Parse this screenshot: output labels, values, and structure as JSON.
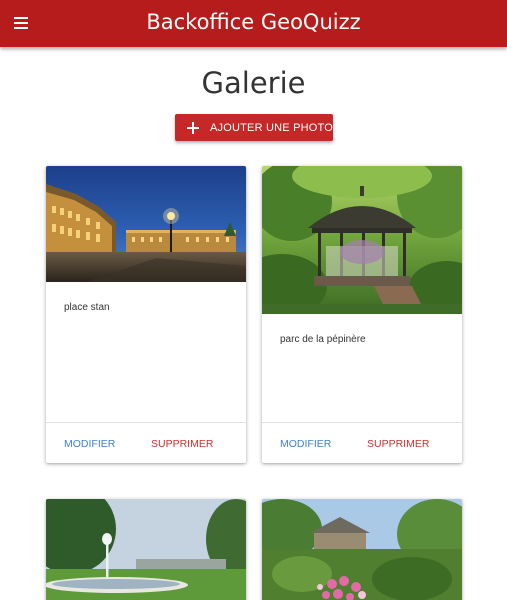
{
  "header": {
    "title": "Backoffice GeoQuizz",
    "menu_icon": "hamburger-menu-icon",
    "color": "#b71c1c"
  },
  "page": {
    "title": "Galerie"
  },
  "add_button": {
    "label": "AJOUTER UNE PHOTO",
    "icon": "plus-icon",
    "color": "#c62828"
  },
  "cards": [
    {
      "caption": "place stan",
      "modify_label": "MODIFIER",
      "delete_label": "SUPPRIMER"
    },
    {
      "caption": "parc de la pépinère",
      "modify_label": "MODIFIER",
      "delete_label": "SUPPRIMER"
    },
    {
      "caption": "",
      "modify_label": "",
      "delete_label": ""
    },
    {
      "caption": "",
      "modify_label": "",
      "delete_label": ""
    }
  ],
  "colors": {
    "action_edit": "#3f7fd6",
    "action_delete": "#d32f2f"
  }
}
